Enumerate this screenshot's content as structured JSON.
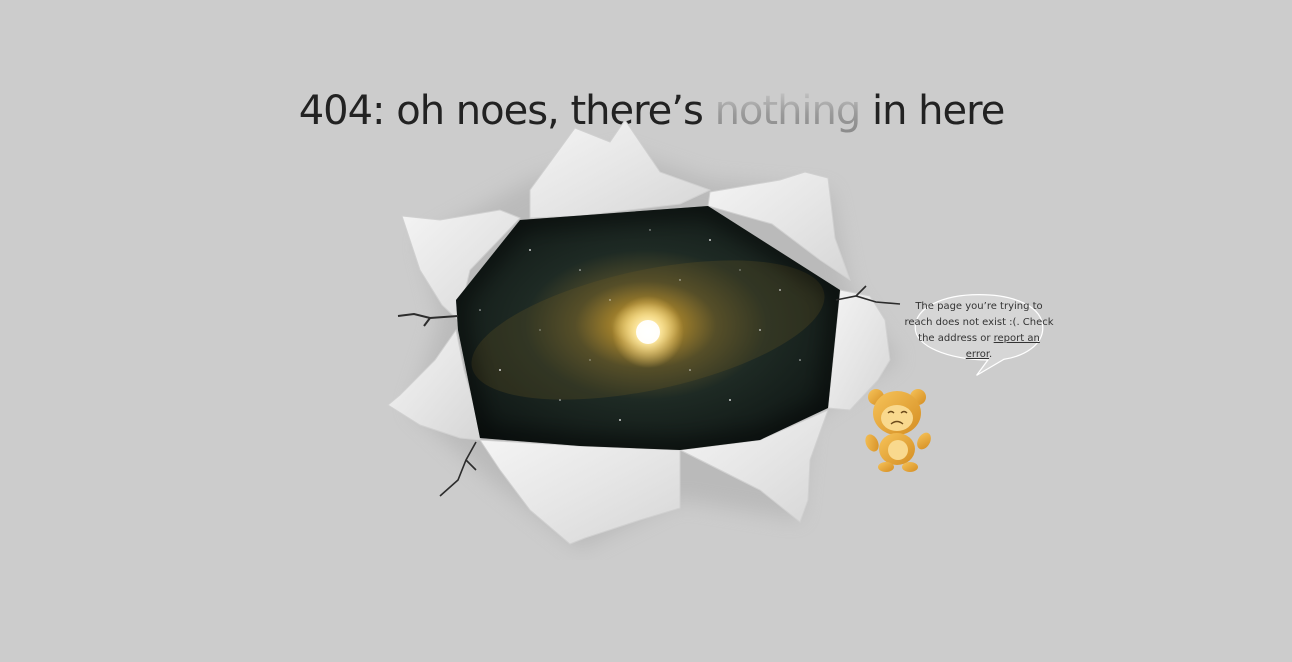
{
  "headline": {
    "prefix": "404: oh noes, there’s ",
    "highlight": "nothing",
    "suffix": " in here"
  },
  "bubble": {
    "message": "The page you’re trying to reach does not exist :(. Check the address or ",
    "link_label": "report an error",
    "suffix": "."
  },
  "colors": {
    "background": "#cccccc",
    "headline": "#222222",
    "mascot": "#e8a93a",
    "galaxy_core": "#fff1b0"
  },
  "icons": {
    "torn_hole": "torn-paper-hole-with-galaxy",
    "mascot": "sad-bear-mascot"
  }
}
